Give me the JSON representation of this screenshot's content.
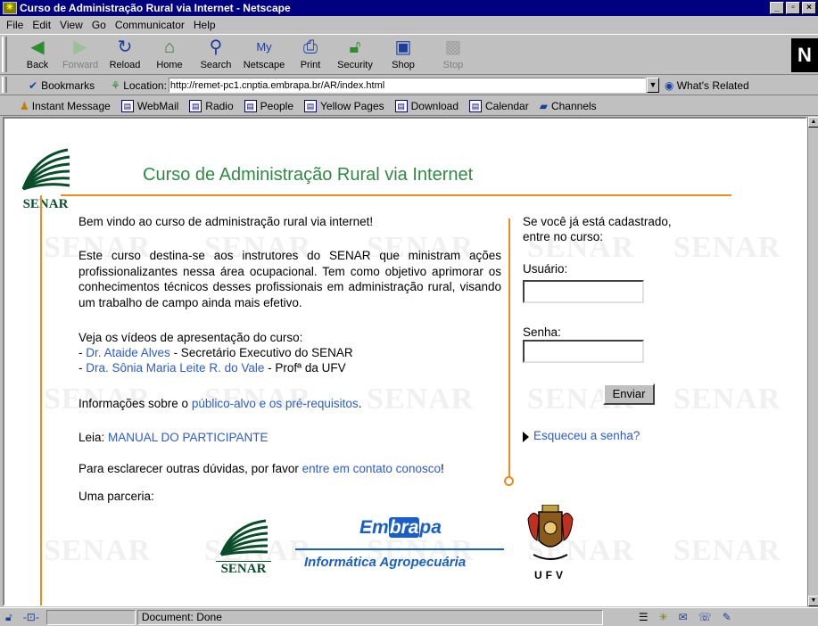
{
  "window": {
    "title": "Curso de Administração Rural via Internet - Netscape",
    "controls": [
      "_",
      "▫",
      "×"
    ]
  },
  "menu": [
    {
      "label": "File"
    },
    {
      "label": "Edit"
    },
    {
      "label": "View"
    },
    {
      "label": "Go"
    },
    {
      "label": "Communicator"
    },
    {
      "label": "Help"
    }
  ],
  "nav": {
    "back": "Back",
    "forward": "Forward",
    "reload": "Reload",
    "home": "Home",
    "search": "Search",
    "netscape": "Netscape",
    "print": "Print",
    "security": "Security",
    "shop": "Shop",
    "stop": "Stop",
    "logo": "N"
  },
  "location": {
    "bookmarks": "Bookmarks",
    "label": "Location:",
    "url": "http://remet-pc1.cnptia.embrapa.br/AR/index.html",
    "whats_related": "What's Related"
  },
  "personal": [
    {
      "label": "Instant Message",
      "icon": "person-icon"
    },
    {
      "label": "WebMail",
      "icon": "doc-icon"
    },
    {
      "label": "Radio",
      "icon": "doc-icon"
    },
    {
      "label": "People",
      "icon": "doc-icon"
    },
    {
      "label": "Yellow Pages",
      "icon": "doc-icon"
    },
    {
      "label": "Download",
      "icon": "doc-icon"
    },
    {
      "label": "Calendar",
      "icon": "doc-icon"
    },
    {
      "label": "Channels",
      "icon": "channels-icon"
    }
  ],
  "page": {
    "logo": "SENAR",
    "title": "Curso de Administração Rural via Internet",
    "welcome": "Bem vindo ao curso de administração rural via internet!",
    "intro": "Este curso destina-se aos instrutores do SENAR que ministram ações profissionalizantes nessa área ocupacional. Tem como objetivo aprimorar os conhecimentos técnicos desses profissionais em administração rural, visando um trabalho de campo ainda mais efetivo.",
    "videos_heading": "Veja os vídeos de apresentação do curso:",
    "video1_prefix": "- ",
    "video1_link": "Dr. Ataide Alves",
    "video1_suffix": " - Secretário Executivo do SENAR",
    "video2_prefix": "- ",
    "video2_link": "Dra. Sônia Maria Leite R. do Vale",
    "video2_suffix": " - Profª da UFV",
    "info_prefix": "Informações sobre o ",
    "info_link": "público-alvo e os pré-requisitos",
    "info_suffix": ".",
    "read_prefix": "Leia: ",
    "read_link": "MANUAL DO PARTICIPANTE",
    "contact_prefix": "Para esclarecer outras dúvidas, por favor ",
    "contact_link": "entre em contato conosco",
    "contact_suffix": "!",
    "partnership": "Uma parceria:",
    "login_line1": "Se você já está cadastrado,",
    "login_line2": "entre no curso:",
    "user_label": "Usuário:",
    "user_value": "",
    "pass_label": "Senha:",
    "pass_value": "",
    "submit": "Enviar",
    "forgot": "Esqueceu a senha?",
    "partner_senar": "SENAR",
    "embrapa_em": "Em",
    "embrapa_bra": "bra",
    "embrapa_pa": "pa",
    "embrapa_sub": "Informática Agropecuária",
    "ufv": "UFV",
    "watermark": "SENAR"
  },
  "status": {
    "text": "Document: Done"
  },
  "colors": {
    "title_green": "#2f8a43",
    "accent_orange": "#e88d22",
    "link_blue": "#2a5ccf",
    "embrapa_blue": "#1a5fc9"
  }
}
